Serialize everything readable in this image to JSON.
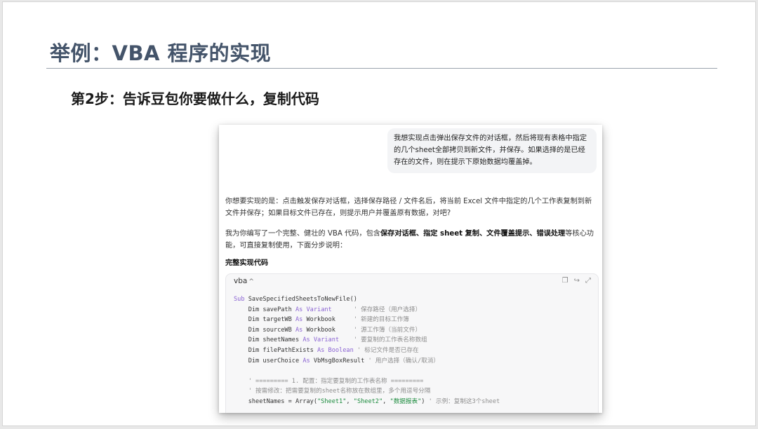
{
  "slide": {
    "title": "举例：VBA 程序的实现",
    "step": "第2步：告诉豆包你要做什么，复制代码"
  },
  "chat": {
    "user_message": "我想实现点击弹出保存文件的对话框，然后将现有表格中指定的几个sheet全部拷贝到新文件，并保存。如果选择的是已经存在的文件，则在提示下原始数据均覆盖掉。",
    "reply_p1": "你想要实现的是：点击触发保存对话框，选择保存路径 / 文件名后，将当前 Excel 文件中指定的几个工作表复制到新文件并保存；如果目标文件已存在，则提示用户并覆盖原有数据，对吧?",
    "reply_p2_pre": "我为你编写了一个完整、健壮的 VBA 代码，包含",
    "reply_p2_bold": "保存对话框、指定 sheet 复制、文件覆盖提示、错误处理",
    "reply_p2_post": "等核心功能，可直接复制使用，下面分步说明：",
    "section_heading": "完整实现代码"
  },
  "code_block": {
    "language": "vba",
    "collapse_icon": "chevron-up-icon",
    "copy_icon": "copy-icon",
    "share_icon": "share-icon",
    "expand_icon": "expand-icon",
    "lines": {
      "l1_kw": "Sub",
      "l1_rest": " SaveSpecifiedSheetsToNewFile()",
      "l2_var": "    Dim savePath ",
      "l2_as": "As ",
      "l2_type": "Variant",
      "l2_cm": "      ' 保存路径（用户选择）",
      "l3_var": "    Dim targetWB ",
      "l3_as": "As ",
      "l3_type": "Workbook",
      "l3_cm": "     ' 新建的目标工作簿",
      "l4_var": "    Dim sourceWB ",
      "l4_as": "As ",
      "l4_type": "Workbook",
      "l4_cm": "     ' 源工作簿（当前文件）",
      "l5_var": "    Dim sheetNames ",
      "l5_as": "As ",
      "l5_type": "Variant",
      "l5_cm": "    ' 要复制的工作表名称数组",
      "l6_var": "    Dim filePathExists ",
      "l6_as": "As ",
      "l6_type": "Boolean",
      "l6_cm": " ' 标记文件是否已存在",
      "l7_var": "    Dim userChoice ",
      "l7_as": "As ",
      "l7_type": "VbMsgBoxResult",
      "l7_cm": " ' 用户选择（确认/取消）",
      "l9_cm": "    ' ========= 1. 配置：指定要复制的工作表名称 =========",
      "l10_cm": "    ' 按需修改：把需要复制的sheet名称放在数组里，多个用逗号分隔",
      "l11_pre": "    sheetNames = Array(",
      "l11_s1": "\"Sheet1\"",
      "l11_c1": ", ",
      "l11_s2": "\"Sheet2\"",
      "l11_c2": ", ",
      "l11_s3": "\"数据报表\"",
      "l11_post": ") ",
      "l11_cm": "' 示例：复制这3个sheet"
    }
  },
  "colors": {
    "title": "#44546a",
    "keyword": "#8a63d2",
    "string": "#1a8a3c",
    "comment": "#8e8e8e"
  }
}
